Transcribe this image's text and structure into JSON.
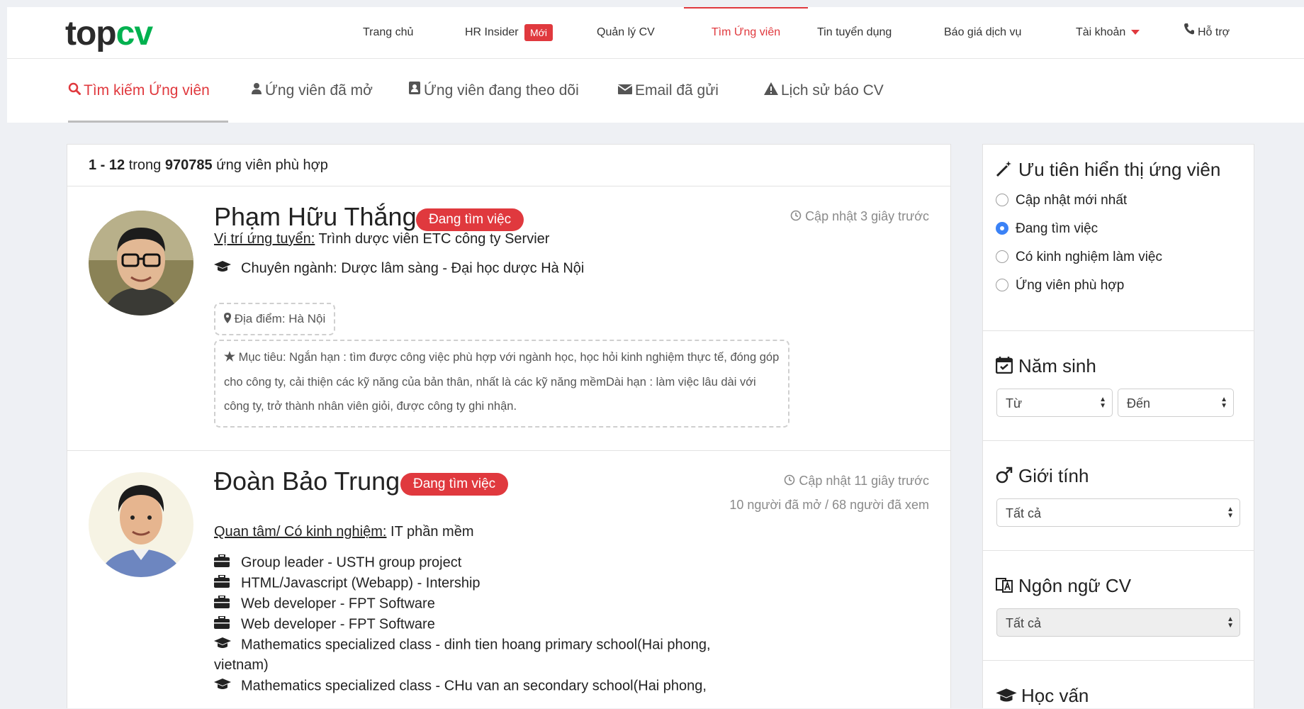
{
  "logo": {
    "part1": "top",
    "part2": "cv"
  },
  "nav": {
    "items": [
      {
        "label": "Trang chủ"
      },
      {
        "label": "HR Insider",
        "badge": "Mới"
      },
      {
        "label": "Quản lý CV"
      },
      {
        "label": "Tìm Ứng viên",
        "active": true
      },
      {
        "label": "Tin tuyển dụng"
      },
      {
        "label": "Báo giá dịch vụ"
      },
      {
        "label": "Tài khoản"
      },
      {
        "label": "Hỗ trợ"
      }
    ]
  },
  "subnav": {
    "items": [
      {
        "label": "Tìm kiếm Ứng viên",
        "icon": "search-icon",
        "active": true
      },
      {
        "label": "Ứng viên đã mở",
        "icon": "user-icon"
      },
      {
        "label": "Ứng viên đang theo dõi",
        "icon": "contact-book-icon"
      },
      {
        "label": "Email đã gửi",
        "icon": "envelope-icon"
      },
      {
        "label": "Lịch sử báo CV",
        "icon": "warning-icon"
      }
    ]
  },
  "results": {
    "range": "1 - 12",
    "in_word": "trong",
    "total": "970785",
    "suffix": "ứng viên phù hợp"
  },
  "candidates": [
    {
      "name": "Phạm Hữu Thắng",
      "status": "Đang tìm việc",
      "updated": "Cập nhật 3 giây trước",
      "position_label": "Vị trí ứng tuyển:",
      "position_value": "Trình dược viên ETC công ty Servier",
      "major": "Chuyên ngành: Dược lâm sàng - Đại học dược Hà Nội",
      "location": "Địa điểm: Hà Nội",
      "goal": "Mục tiêu: Ngắn hạn : tìm được công việc phù hợp với ngành học, học hỏi kinh nghiệm thực tế, đóng góp cho công ty, cải thiện các kỹ năng của bản thân, nhất là các kỹ năng mềmDài hạn : làm việc lâu dài với công ty, trở thành nhân viên giỏi, được công ty ghi nhận."
    },
    {
      "name": "Đoàn Bảo Trung",
      "status": "Đang tìm việc",
      "updated": "Cập nhật 11 giây trước",
      "views": "10 người đã mở / 68 người đã xem",
      "interest_label": "Quan tâm/ Có kinh nghiệm:",
      "interest_value": "IT phần mềm",
      "experience": [
        "Group leader - USTH group project",
        "HTML/Javascript (Webapp) - Intership",
        "Web developer - FPT Software",
        "Web developer - FPT Software"
      ],
      "education_1a": "Mathematics specialized class - dinh tien hoang primary school(Hai phong,",
      "education_1b": "vietnam)",
      "education_2": "Mathematics specialized class - CHu van an secondary school(Hai phong,"
    }
  ],
  "sidebar": {
    "priority": {
      "title": "Ưu tiên hiển thị ứng viên",
      "options": [
        "Cập nhật mới nhất",
        "Đang tìm việc",
        "Có kinh nghiệm làm việc",
        "Ứng viên phù hợp"
      ],
      "selected": "Đang tìm việc"
    },
    "birth_year": {
      "title": "Năm sinh",
      "from": "Từ",
      "to": "Đến"
    },
    "gender": {
      "title": "Giới tính",
      "value": "Tất cả"
    },
    "cv_language": {
      "title": "Ngôn ngữ CV",
      "value": "Tất cả"
    },
    "education": {
      "title": "Học vấn"
    }
  },
  "colors": {
    "accent": "#e0393e",
    "brand_green": "#00b14f",
    "radio_selected": "#3b82f6"
  }
}
